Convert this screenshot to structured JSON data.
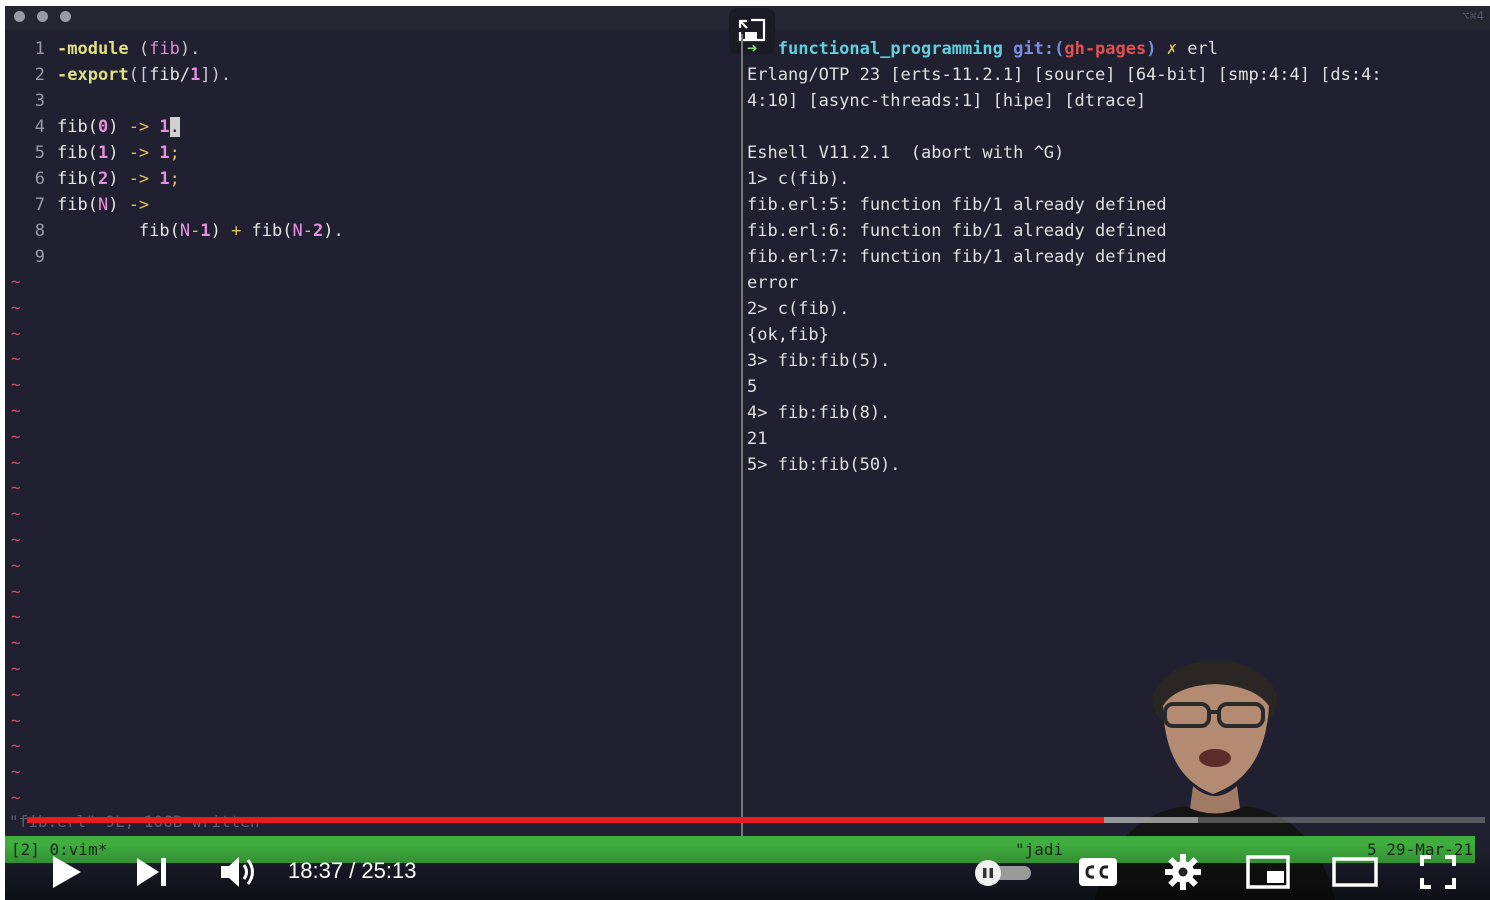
{
  "window": {
    "shortcut": "⌥⌘4"
  },
  "editor": {
    "lines": [
      {
        "n": "1"
      },
      {
        "n": "2"
      },
      {
        "n": "3"
      },
      {
        "n": "4"
      },
      {
        "n": "5"
      },
      {
        "n": "6"
      },
      {
        "n": "7"
      },
      {
        "n": "8"
      },
      {
        "n": "9"
      }
    ],
    "tokens": {
      "l1": [
        "-module",
        "(",
        "fib",
        ")."
      ],
      "l2": [
        "-export",
        "([",
        "fib/",
        "1",
        "])."
      ],
      "l4": [
        "fib(",
        "0",
        ") ",
        "->",
        " ",
        "1",
        "."
      ],
      "l5": [
        "fib(",
        "1",
        ") ",
        "->",
        " ",
        "1",
        ";"
      ],
      "l6": [
        "fib(",
        "2",
        ") ",
        "->",
        " ",
        "1",
        ";"
      ],
      "l7": [
        "fib(",
        "N",
        ") ",
        "->"
      ],
      "l8": [
        "        fib(",
        "N",
        "-",
        "1",
        ") ",
        "+",
        " fib(",
        "N",
        "-",
        "2",
        ")."
      ]
    },
    "status_message": "\"fib.erl\" 9L, 106B written"
  },
  "terminal": {
    "prompt": {
      "arrow": "➜",
      "dir": "functional_programming",
      "git": "git:(",
      "branch": "gh-pages",
      "git_close": ")",
      "dirty": "✗",
      "cmd": "erl"
    },
    "lines": [
      "Erlang/OTP 23 [erts-11.2.1] [source] [64-bit] [smp:4:4] [ds:4:",
      "4:10] [async-threads:1] [hipe] [dtrace]",
      "",
      "Eshell V11.2.1  (abort with ^G)",
      "1> c(fib).",
      "fib.erl:5: function fib/1 already defined",
      "fib.erl:6: function fib/1 already defined",
      "fib.erl:7: function fib/1 already defined",
      "error",
      "2> c(fib).",
      "{ok,fib}",
      "3> fib:fib(5).",
      "5",
      "4> fib:fib(8).",
      "21",
      "5> fib:fib(50)."
    ]
  },
  "tmux": {
    "left": "[2] 0:vim*",
    "host": "\"jadi",
    "date": "5 29-Mar-21"
  },
  "player": {
    "time": "18:37 / 25:13",
    "progress_played": 0.739,
    "progress_buffered": 0.803,
    "autoplay_on": false,
    "colors": {
      "played": "#e81c1c",
      "tmux": "#3fae3f"
    }
  }
}
